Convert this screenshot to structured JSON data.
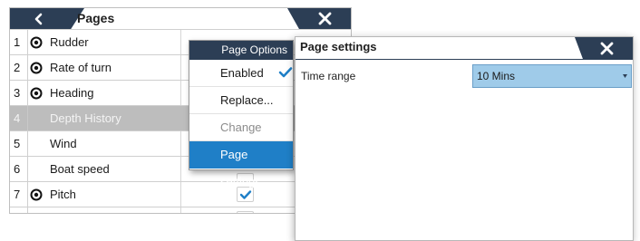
{
  "pages": {
    "title": "Pages",
    "rows": [
      {
        "num": "1",
        "label": "Rudder",
        "has_icon": true,
        "checked": false,
        "partial": false,
        "selected": false
      },
      {
        "num": "2",
        "label": "Rate of turn",
        "has_icon": true,
        "checked": false,
        "partial": false,
        "selected": false
      },
      {
        "num": "3",
        "label": "Heading",
        "has_icon": true,
        "checked": false,
        "partial": false,
        "selected": false
      },
      {
        "num": "4",
        "label": "Depth History",
        "has_icon": false,
        "checked": false,
        "partial": false,
        "selected": true
      },
      {
        "num": "5",
        "label": "Wind",
        "has_icon": false,
        "checked": false,
        "partial": false,
        "selected": false
      },
      {
        "num": "6",
        "label": "Boat speed",
        "has_icon": false,
        "checked": false,
        "partial": true,
        "selected": false
      },
      {
        "num": "7",
        "label": "Pitch",
        "has_icon": true,
        "checked": true,
        "partial": false,
        "selected": false
      }
    ]
  },
  "page_options": {
    "title": "Page Options",
    "items": [
      {
        "label": "Enabled",
        "state": "normal",
        "checked": true
      },
      {
        "label": "Replace...",
        "state": "normal",
        "checked": false
      },
      {
        "label": "Change data...",
        "state": "disabled",
        "checked": false
      },
      {
        "label": "Page settings...",
        "state": "active",
        "checked": false
      }
    ]
  },
  "page_settings": {
    "title": "Page settings",
    "field_label": "Time range",
    "field_value": "10 Mins"
  },
  "colors": {
    "header_navy": "#2c3e55",
    "highlight_blue": "#1f7fc7",
    "select_blue": "#9fcbe9",
    "check_blue": "#1f7fc7",
    "selected_row_gray": "#bdbdbd"
  },
  "icons": {
    "back": "chevron-left-icon",
    "close": "close-icon",
    "row_marker": "target-icon",
    "check": "checkmark-icon",
    "dropdown": "caret-down-icon"
  }
}
